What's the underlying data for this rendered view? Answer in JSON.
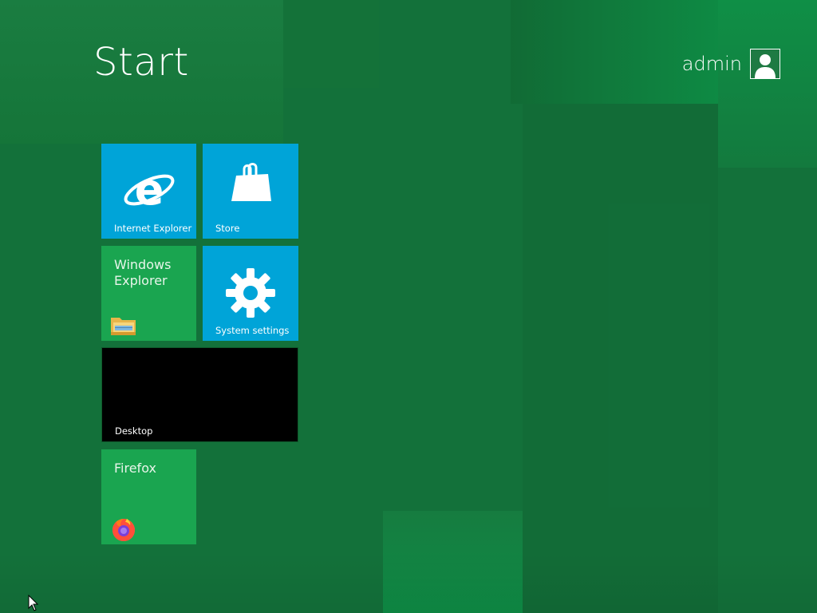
{
  "start": {
    "title": "Start"
  },
  "user": {
    "name": "admin",
    "avatar_icon": "user-silhouette-icon"
  },
  "tiles": {
    "internet_explorer": {
      "label": "Internet Explorer",
      "icon": "internet-explorer-icon",
      "color": "#00a4d8"
    },
    "store": {
      "label": "Store",
      "icon": "shopping-bag-icon",
      "color": "#00a4d8"
    },
    "windows_explorer": {
      "title": "Windows Explorer",
      "icon": "folder-icon",
      "color": "#1aa550"
    },
    "system_settings": {
      "label": "System settings",
      "icon": "gear-icon",
      "color": "#00a4d8"
    },
    "desktop": {
      "label": "Desktop",
      "color": "#000000"
    },
    "firefox": {
      "title": "Firefox",
      "icon": "firefox-icon",
      "color": "#1aa550"
    }
  },
  "colors": {
    "background": "#13713a",
    "tile_blue": "#00a4d8",
    "tile_green": "#1aa550"
  },
  "cursor": {
    "icon": "mouse-pointer-icon"
  }
}
